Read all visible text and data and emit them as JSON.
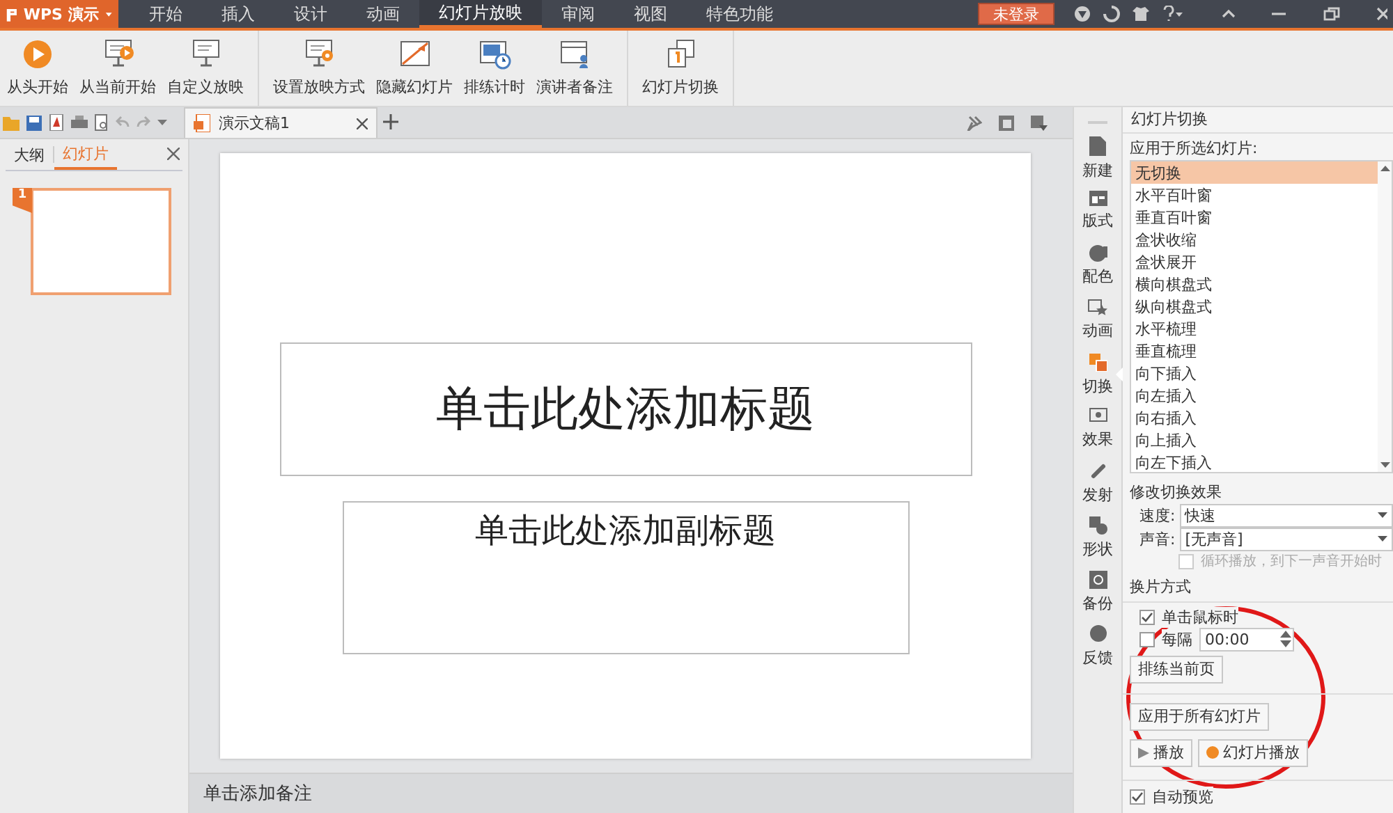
{
  "app_menu": {
    "label": "WPS 演示"
  },
  "menu_tabs": [
    {
      "label": "开始",
      "selected": false
    },
    {
      "label": "插入",
      "selected": false
    },
    {
      "label": "设计",
      "selected": false
    },
    {
      "label": "动画",
      "selected": false
    },
    {
      "label": "幻灯片放映",
      "selected": true
    },
    {
      "label": "审阅",
      "selected": false
    },
    {
      "label": "视图",
      "selected": false
    },
    {
      "label": "特色功能",
      "selected": false
    }
  ],
  "login_button": "未登录",
  "ribbon_groups": [
    [
      {
        "label": "从头开始",
        "kind": "play"
      },
      {
        "label": "从当前开始",
        "kind": "play-screen"
      },
      {
        "label": "自定义放映",
        "kind": "screen"
      }
    ],
    [
      {
        "label": "设置放映方式",
        "kind": "gear-screen"
      },
      {
        "label": "隐藏幻灯片",
        "kind": "hide"
      },
      {
        "label": "排练计时",
        "kind": "timer"
      },
      {
        "label": "演讲者备注",
        "kind": "notes"
      }
    ],
    [
      {
        "label": "幻灯片切换",
        "kind": "switch"
      }
    ]
  ],
  "document_tabs": [
    {
      "label": "演示文稿1",
      "selected": true
    }
  ],
  "left_pane": {
    "tabs": [
      {
        "label": "大纲",
        "selected": false
      },
      {
        "label": "幻灯片",
        "selected": true
      }
    ],
    "slides": [
      {
        "number": "1",
        "selected": true
      }
    ]
  },
  "slide": {
    "title_placeholder": "单击此处添加标题",
    "subtitle_placeholder": "单击此处添加副标题"
  },
  "notes": {
    "placeholder": "单击添加备注"
  },
  "side_tools": [
    {
      "label": "新建",
      "kind": "new",
      "selected": false
    },
    {
      "label": "版式",
      "kind": "layout",
      "selected": false
    },
    {
      "label": "配色",
      "kind": "palette",
      "selected": false
    },
    {
      "label": "动画",
      "kind": "animation",
      "selected": false
    },
    {
      "label": "切换",
      "kind": "switch",
      "selected": true
    },
    {
      "label": "效果",
      "kind": "effect",
      "selected": false
    },
    {
      "label": "发射",
      "kind": "link",
      "selected": false
    },
    {
      "label": "形状",
      "kind": "shape",
      "selected": false
    },
    {
      "label": "备份",
      "kind": "backup",
      "selected": false
    },
    {
      "label": "反馈",
      "kind": "feedback",
      "selected": false
    }
  ],
  "transition_panel": {
    "title": "幻灯片切换",
    "apply_label": "应用于所选幻灯片:",
    "effects": [
      {
        "label": "无切换",
        "selected": true
      },
      {
        "label": "水平百叶窗",
        "selected": false
      },
      {
        "label": "垂直百叶窗",
        "selected": false
      },
      {
        "label": "盒状收缩",
        "selected": false
      },
      {
        "label": "盒状展开",
        "selected": false
      },
      {
        "label": "横向棋盘式",
        "selected": false
      },
      {
        "label": "纵向棋盘式",
        "selected": false
      },
      {
        "label": "水平梳理",
        "selected": false
      },
      {
        "label": "垂直梳理",
        "selected": false
      },
      {
        "label": "向下插入",
        "selected": false
      },
      {
        "label": "向左插入",
        "selected": false
      },
      {
        "label": "向右插入",
        "selected": false
      },
      {
        "label": "向上插入",
        "selected": false
      },
      {
        "label": "向左下插入",
        "selected": false
      }
    ],
    "modify_heading": "修改切换效果",
    "speed": {
      "label": "速度:",
      "value": "快速"
    },
    "sound": {
      "label": "声音:",
      "value": "[无声音]"
    },
    "loop": {
      "label": "循环播放，到下一声音开始时",
      "checked": false,
      "disabled": true
    },
    "advance_heading": "换片方式",
    "on_click": {
      "label": "单击鼠标时",
      "checked": true
    },
    "every": {
      "label": "每隔",
      "checked": false,
      "value": "00:00"
    },
    "rehearse_button": "排练当前页",
    "apply_all_button": "应用于所有幻灯片",
    "play_button": "播放",
    "slideshow_button": "幻灯片播放",
    "auto_preview": {
      "label": "自动预览",
      "checked": true
    }
  }
}
